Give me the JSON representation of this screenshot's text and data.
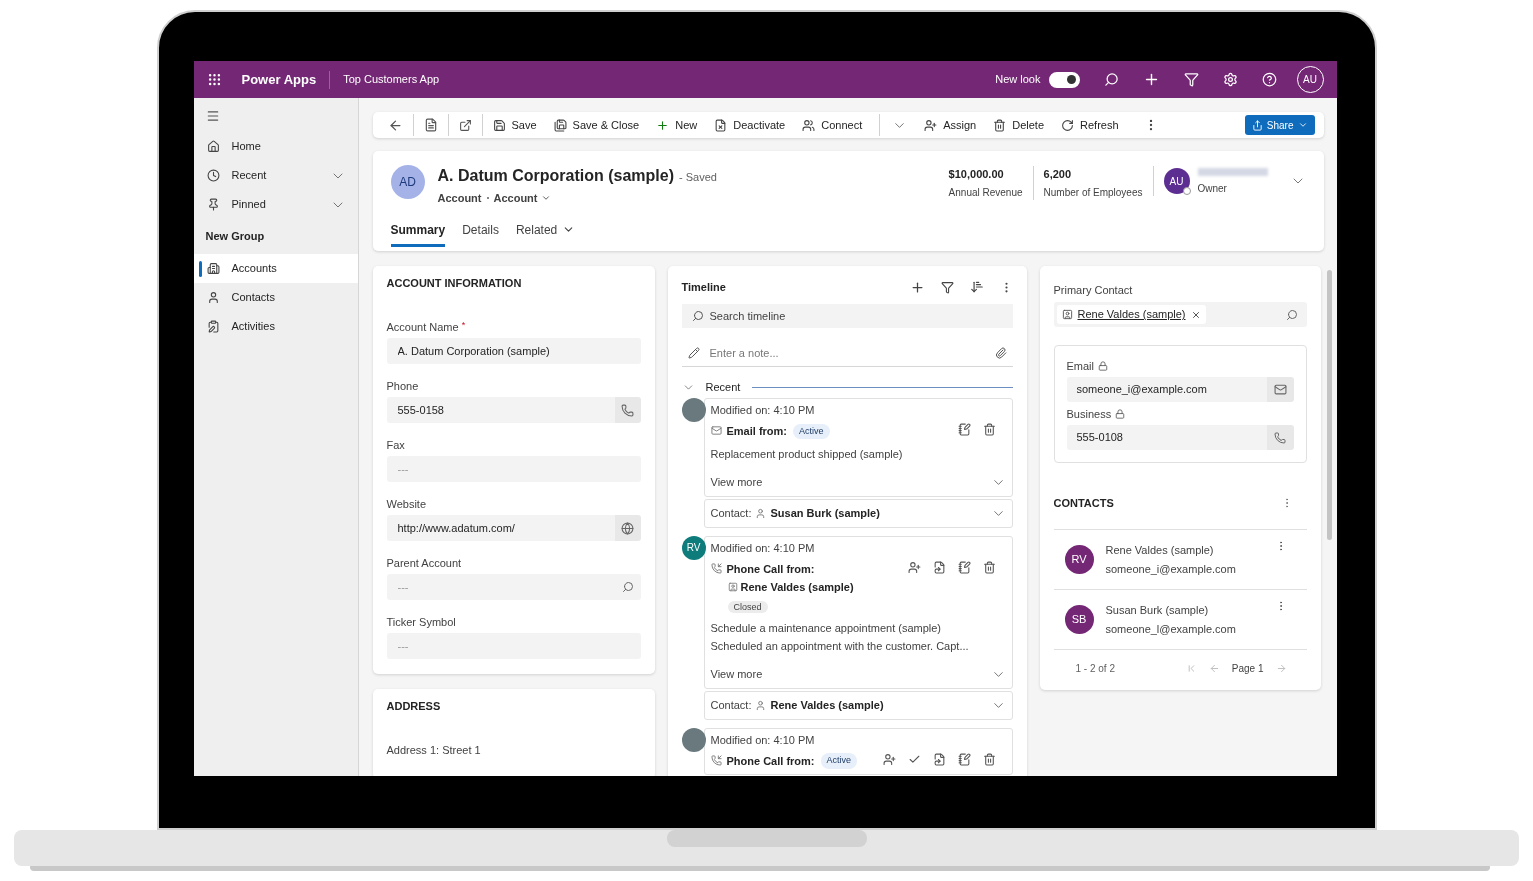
{
  "header": {
    "app_name": "Power Apps",
    "app_title": "Top Customers App",
    "new_look": {
      "label": "New look",
      "on": true
    },
    "user_initials": "AU"
  },
  "sidebar": {
    "items": [
      {
        "label": "Home",
        "kind": "link",
        "selected": false
      },
      {
        "label": "Recent",
        "kind": "flyout",
        "selected": false
      },
      {
        "label": "Pinned",
        "kind": "flyout",
        "selected": false
      }
    ],
    "group": {
      "title": "New Group",
      "items": [
        {
          "label": "Accounts",
          "selected": true
        },
        {
          "label": "Contacts",
          "selected": false
        },
        {
          "label": "Activities",
          "selected": false
        }
      ]
    }
  },
  "command_bar": {
    "commands": [
      {
        "label": "Save",
        "split": false
      },
      {
        "label": "Save & Close",
        "split": false
      },
      {
        "label": "New",
        "split": false
      },
      {
        "label": "Deactivate",
        "split": false
      },
      {
        "label": "Connect",
        "split": true
      },
      {
        "label": "Assign",
        "split": false
      },
      {
        "label": "Delete",
        "split": false
      },
      {
        "label": "Refresh",
        "split": false
      }
    ],
    "share": "Share"
  },
  "record": {
    "avatar": "AD",
    "title": "A. Datum Corporation (sample)",
    "status": "- Saved",
    "entity": "Account",
    "form": "Account",
    "tabs": [
      {
        "label": "Summary",
        "selected": true,
        "menu": false
      },
      {
        "label": "Details",
        "selected": false,
        "menu": false
      },
      {
        "label": "Related",
        "selected": false,
        "menu": true
      }
    ],
    "key_fields": [
      {
        "value": "$10,000.00",
        "label": "Annual Revenue"
      },
      {
        "value": "6,200",
        "label": "Number of Employees"
      }
    ],
    "owner": {
      "initials": "AU",
      "label": "Owner"
    }
  },
  "account_information": {
    "title": "ACCOUNT INFORMATION",
    "fields": [
      {
        "label": "Account Name",
        "required_mark": "*",
        "kind": "text",
        "value": "A. Datum Corporation (sample)"
      },
      {
        "label": "Phone",
        "kind": "phone",
        "value": "555-0158"
      },
      {
        "label": "Fax",
        "kind": "text",
        "placeholder": "---"
      },
      {
        "label": "Website",
        "kind": "url",
        "value": "http://www.adatum.com/"
      },
      {
        "label": "Parent Account",
        "kind": "lookup",
        "placeholder": "---"
      },
      {
        "label": "Ticker Symbol",
        "kind": "text",
        "placeholder": "---"
      }
    ]
  },
  "address": {
    "title": "ADDRESS",
    "fields": [
      {
        "label": "Address 1: Street 1"
      }
    ]
  },
  "timeline": {
    "title": "Timeline",
    "search_placeholder": "Search timeline",
    "note_placeholder": "Enter a note...",
    "section": "Recent",
    "items": [
      {
        "kind": "email",
        "avatar": {
          "color": "#69797e"
        },
        "modified": "Modified on: 4:10 PM",
        "type_label": "Email from:",
        "status": {
          "label": "Active",
          "kind": "active"
        },
        "subject": "Replacement product shipped (sample)",
        "view_more": "View more",
        "contact_label": "Contact:",
        "contact": "Susan Burk (sample)"
      },
      {
        "kind": "phone_call",
        "avatar": {
          "initials": "RV",
          "color": "#0e7c7b"
        },
        "modified": "Modified on: 4:10 PM",
        "type_label": "Phone Call from:",
        "from": "Rene Valdes (sample)",
        "status": {
          "label": "Closed",
          "kind": "closed"
        },
        "subject": "Schedule a maintenance appointment (sample)",
        "description": "Scheduled an appointment with the customer. Capt...",
        "view_more": "View more",
        "contact_label": "Contact:",
        "contact": "Rene Valdes (sample)"
      },
      {
        "kind": "phone_call",
        "avatar": {
          "color": "#69797e"
        },
        "modified": "Modified on: 4:10 PM",
        "type_label": "Phone Call from:",
        "status": {
          "label": "Active",
          "kind": "active"
        }
      }
    ]
  },
  "primary_contact": {
    "label": "Primary Contact",
    "value": "Rene Valdes (sample)",
    "details": [
      {
        "label": "Email",
        "locked": true,
        "kind": "email",
        "value": "someone_i@example.com"
      },
      {
        "label": "Business",
        "locked": true,
        "kind": "phone",
        "value": "555-0108"
      }
    ]
  },
  "contacts": {
    "title": "CONTACTS",
    "rows": [
      {
        "initials": "RV",
        "name": "Rene Valdes (sample)",
        "email": "someone_i@example.com"
      },
      {
        "initials": "SB",
        "name": "Susan Burk (sample)",
        "email": "someone_l@example.com"
      }
    ],
    "count": "1 - 2 of 2",
    "page": "Page 1"
  }
}
